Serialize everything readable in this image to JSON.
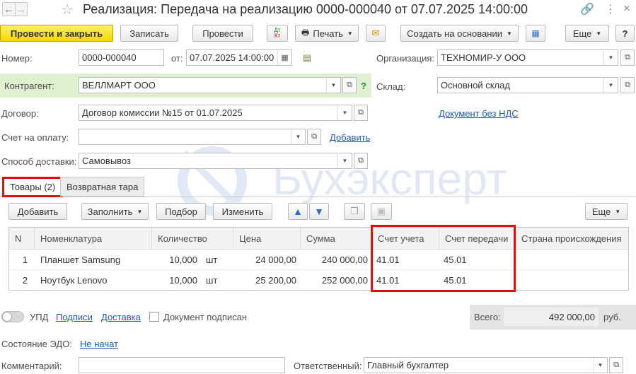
{
  "window": {
    "title": "Реализация: Передача на реализацию 0000-000040 от 07.07.2025 14:00:00"
  },
  "toolbar": {
    "post_close": "Провести и закрыть",
    "save": "Записать",
    "post": "Провести",
    "dtkt": "Дт Кт",
    "print": "Печать",
    "create_based": "Создать на основании",
    "more": "Еще",
    "help": "?"
  },
  "form": {
    "number_label": "Номер:",
    "number_value": "0000-000040",
    "date_label": "от:",
    "date_value": "07.07.2025 14:00:00",
    "org_label": "Организация:",
    "org_value": "ТЕХНОМИР-У ООО",
    "counterparty_label": "Контрагент:",
    "counterparty_value": "ВЕЛЛМАРТ ООО",
    "warehouse_label": "Склад:",
    "warehouse_value": "Основной склад",
    "contract_label": "Договор:",
    "contract_value": "Договор комиссии №15 от 01.07.2025",
    "vat_link": "Документ без НДС",
    "invoice_label": "Счет на оплату:",
    "invoice_value": "",
    "add_link": "Добавить",
    "delivery_label": "Способ доставки:",
    "delivery_value": "Самовывоз",
    "help_mark": "?"
  },
  "tabs": [
    {
      "label": "Товары (2)"
    },
    {
      "label": "Возвратная тара"
    }
  ],
  "table_toolbar": {
    "add": "Добавить",
    "fill": "Заполнить",
    "select": "Подбор",
    "edit": "Изменить",
    "more": "Еще"
  },
  "table": {
    "columns": [
      "N",
      "Номенклатура",
      "Количество",
      "Цена",
      "Сумма",
      "Счет учета",
      "Счет передачи",
      "Страна происхождения"
    ],
    "rows": [
      {
        "n": "1",
        "name": "Планшет Samsung",
        "qty": "10,000",
        "unit": "шт",
        "price": "24 000,00",
        "sum": "240 000,00",
        "acc": "41.01",
        "acc2": "45.01",
        "country": ""
      },
      {
        "n": "2",
        "name": "Ноутбук Lenovo",
        "qty": "10,000",
        "unit": "шт",
        "price": "25 200,00",
        "sum": "252 000,00",
        "acc": "41.01",
        "acc2": "45.01",
        "country": ""
      }
    ]
  },
  "footer": {
    "upd_label": "УПД",
    "signatures_link": "Подписи",
    "delivery_link": "Доставка",
    "signed_label": "Документ подписан",
    "total_label": "Всего:",
    "total_value": "492 000,00",
    "currency": "руб.",
    "edo_label": "Состояние ЭДО:",
    "edo_link": "Не начат",
    "comment_label": "Комментарий:",
    "comment_value": "",
    "responsible_label": "Ответственный:",
    "responsible_value": "Главный бухгалтер"
  },
  "watermark": "Бухэксперт",
  "colors": {
    "primary_button": "#f4d800",
    "link": "#1c58b5",
    "highlight_box": "#e01010",
    "counterparty_bg": "#dff0d0"
  }
}
